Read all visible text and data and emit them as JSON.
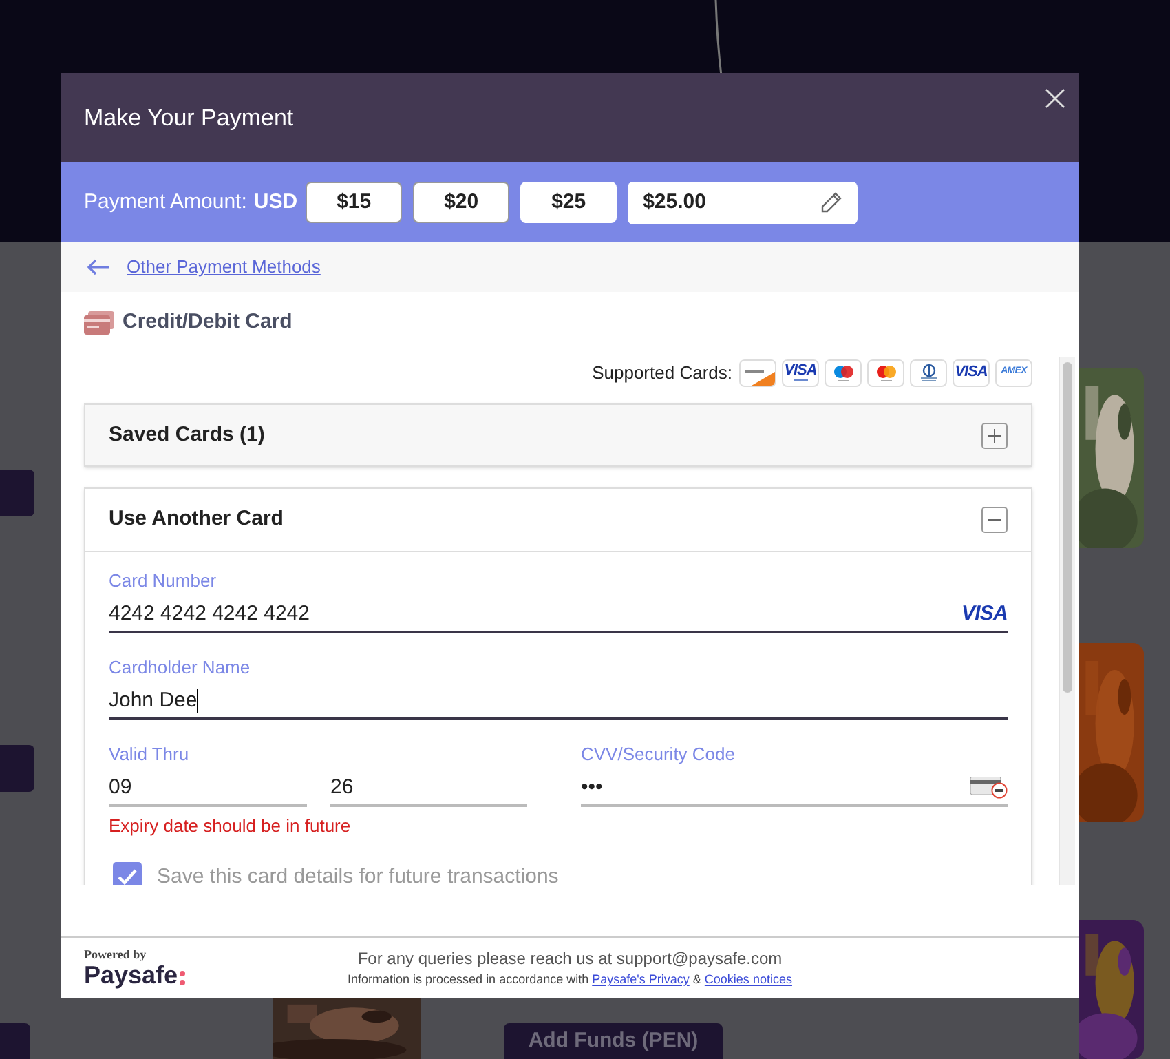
{
  "background": {
    "button_label": "Add Funds (PEN)"
  },
  "modal": {
    "title": "Make Your Payment"
  },
  "amount": {
    "label": "Payment Amount:",
    "currency": "USD",
    "presets": [
      {
        "label": "$15",
        "selected": false
      },
      {
        "label": "$20",
        "selected": false
      },
      {
        "label": "$25",
        "selected": true
      }
    ],
    "custom_value": "$25.00"
  },
  "back_link": "Other Payment Methods",
  "method_title": "Credit/Debit Card",
  "supported": {
    "label": "Supported Cards:",
    "cards": [
      {
        "kind": "discover"
      },
      {
        "kind": "visa_electron",
        "text": "VISA"
      },
      {
        "kind": "maestro"
      },
      {
        "kind": "mastercard"
      },
      {
        "kind": "diners"
      },
      {
        "kind": "visa",
        "text": "VISA"
      },
      {
        "kind": "amex",
        "text": "AMEX"
      }
    ]
  },
  "saved_cards": {
    "title": "Saved Cards (1)",
    "expanded": false
  },
  "another_card": {
    "title": "Use Another Card",
    "expanded": true
  },
  "form": {
    "card_number": {
      "label": "Card Number",
      "value": "4242 4242 4242 4242",
      "brand": "VISA"
    },
    "cardholder": {
      "label": "Cardholder Name",
      "value": "John Dee"
    },
    "valid_thru": {
      "label": "Valid Thru",
      "month": "09",
      "year": "26"
    },
    "cvv": {
      "label": "CVV/Security Code",
      "value": "•••"
    },
    "error": "Expiry date should be in future",
    "save_card": {
      "label": "Save this card details for future transactions",
      "checked": true
    }
  },
  "footer": {
    "powered_by": "Powered by",
    "brand": "Paysafe",
    "query": "For any queries please reach us at support@paysafe.com",
    "notice": "Information is processed in accordance with",
    "link1": "Paysafe's Privacy",
    "amp": "&",
    "link2": "Cookies notices"
  }
}
